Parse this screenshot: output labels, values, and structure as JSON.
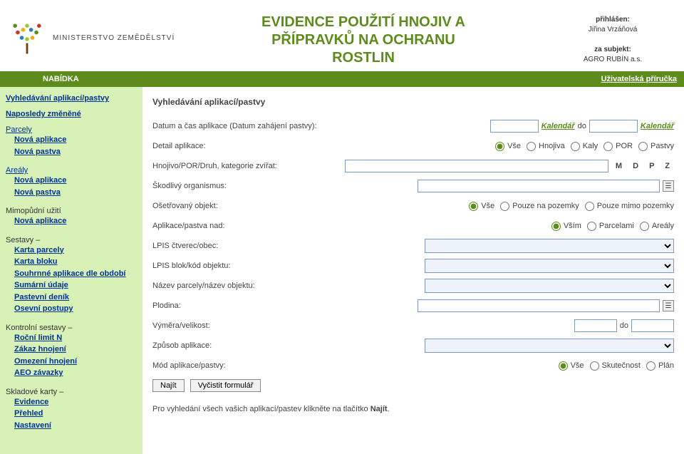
{
  "header": {
    "ministry": "MINISTERSTVO ZEMĚDĚLSTVÍ",
    "title_l1": "EVIDENCE POUŽITÍ HNOJIV A",
    "title_l2": "PŘÍPRAVKŮ NA OCHRANU",
    "title_l3": "ROSTLIN",
    "login_label": "přihlášen:",
    "login_user": "Jiřina Vrzáňová",
    "subject_label": "za subjekt:",
    "subject_name": "AGRO RUBÍN a.s."
  },
  "bar": {
    "menu": "NABÍDKA",
    "guide": "Uživatelská příručka"
  },
  "sidebar": {
    "top1": "Vyhledávání aplikací/pastvy",
    "top2": "Naposledy změněné",
    "parcely": {
      "head": "Parcely",
      "nova_apl": "Nová aplikace",
      "nova_pas": "Nová pastva"
    },
    "arealy": {
      "head": "Areály",
      "nova_apl": "Nová aplikace",
      "nova_pas": "Nová pastva"
    },
    "mimo": {
      "head": "Mimopůdní užití",
      "nova_apl": "Nová aplikace"
    },
    "sestavy": {
      "head": "Sestavy –",
      "items": [
        "Karta parcely",
        "Karta bloku",
        "Souhrnné aplikace dle období",
        "Sumární údaje",
        "Pastevní deník",
        "Osevní postupy"
      ]
    },
    "kontrolni": {
      "head": "Kontrolní sestavy –",
      "items": [
        "Roční limit N",
        "Zákaz hnojení",
        "Omezení hnojení",
        "AEO závazky"
      ]
    },
    "sklad": {
      "head": "Skladové karty –",
      "items": [
        "Evidence",
        "Přehled",
        "Nastavení"
      ]
    }
  },
  "form": {
    "heading": "Vyhledávání aplikací/pastvy",
    "labels": {
      "datum": "Datum a čas aplikace (Datum zahájení pastvy):",
      "detail": "Detail aplikace:",
      "hnojivo": "Hnojivo/POR/Druh, kategorie zvířat:",
      "skodlivy": "Škodlivý organismus:",
      "osetrovany": "Ošetřovaný objekt:",
      "aplikace_nad": "Aplikace/pastva nad:",
      "lpis_ctv": "LPIS čtverec/obec:",
      "lpis_blok": "LPIS blok/kód objektu:",
      "nazev": "Název parcely/název objektu:",
      "plodina": "Plodina:",
      "vymera": "Výměra/velikost:",
      "zpusob": "Způsob aplikace:",
      "mod": "Mód aplikace/pastvy:"
    },
    "kalendar": "Kalendář",
    "do": "do",
    "mdpz": "M D P Z",
    "detail_opts": [
      "Vše",
      "Hnojiva",
      "Kaly",
      "POR",
      "Pastvy"
    ],
    "osetrovany_opts": [
      "Vše",
      "Pouze na pozemky",
      "Pouze mimo pozemky"
    ],
    "nad_opts": [
      "Vším",
      "Parcelami",
      "Areály"
    ],
    "mod_opts": [
      "Vše",
      "Skutečnost",
      "Plán"
    ],
    "btn_najit": "Najít",
    "btn_clear": "Vyčistit formulář",
    "hint_pre": "Pro vyhledání všech vašich aplikací/pastev klikněte na tlačítko ",
    "hint_b": "Najít",
    "hint_post": "."
  }
}
